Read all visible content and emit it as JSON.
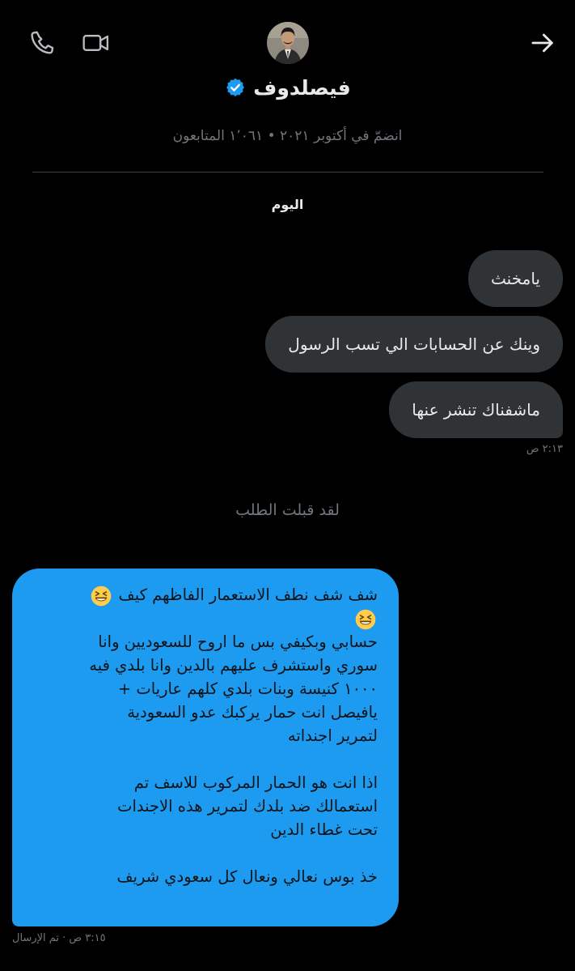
{
  "header": {
    "name": "فيصلدوف",
    "verified": true,
    "meta": "انضمّ في أكتوبر ٢٠٢١ • ١٬٠٦١ المتابعون",
    "icons": {
      "back": "arrow-right-icon",
      "call": "phone-icon",
      "video": "video-camera-icon",
      "badge": "verified-badge-icon"
    }
  },
  "conversation": {
    "date_separator": "اليوم",
    "outgoing": [
      {
        "text": "يامخنث"
      },
      {
        "text": "وينك عن الحسابات الي تسب الرسول"
      },
      {
        "text": "ماشفناك تنشر عنها"
      }
    ],
    "outgoing_time": "٢:١٣ ص",
    "request_note": "لقد قبلت الطلب",
    "incoming": {
      "lines": [
        "شف شف نطف الاستعمار الفاظهم كيف",
        "",
        "حسابي وبكيفي بس ما اروح للسعوديين وانا",
        "سوري واستشرف عليهم بالدين وانا بلدي فيه",
        "١٠٠٠ كنيسة وبنات بلدي كلهم عاريات +",
        "يافيصل انت حمار يركبك عدو السعودية",
        "لتمرير اجنداته",
        "",
        "اذا انت هو الحمار المركوب للاسف تم",
        "استعمالك ضد بلدك لتمرير هذه الاجندات",
        "تحت غطاء الدين",
        "",
        "خذ بوس نعالي ونعال كل سعودي شريف"
      ],
      "emoji": "laughing-face-emoji"
    },
    "incoming_status": "٣:١٥ ص · تم الإرسال"
  },
  "colors": {
    "background": "#000000",
    "outgoing_bubble": "#2f3336",
    "incoming_bubble": "#1d9bf0",
    "muted_text": "#71767b",
    "primary_text": "#e7e9ea",
    "verified": "#1d9bf0"
  }
}
